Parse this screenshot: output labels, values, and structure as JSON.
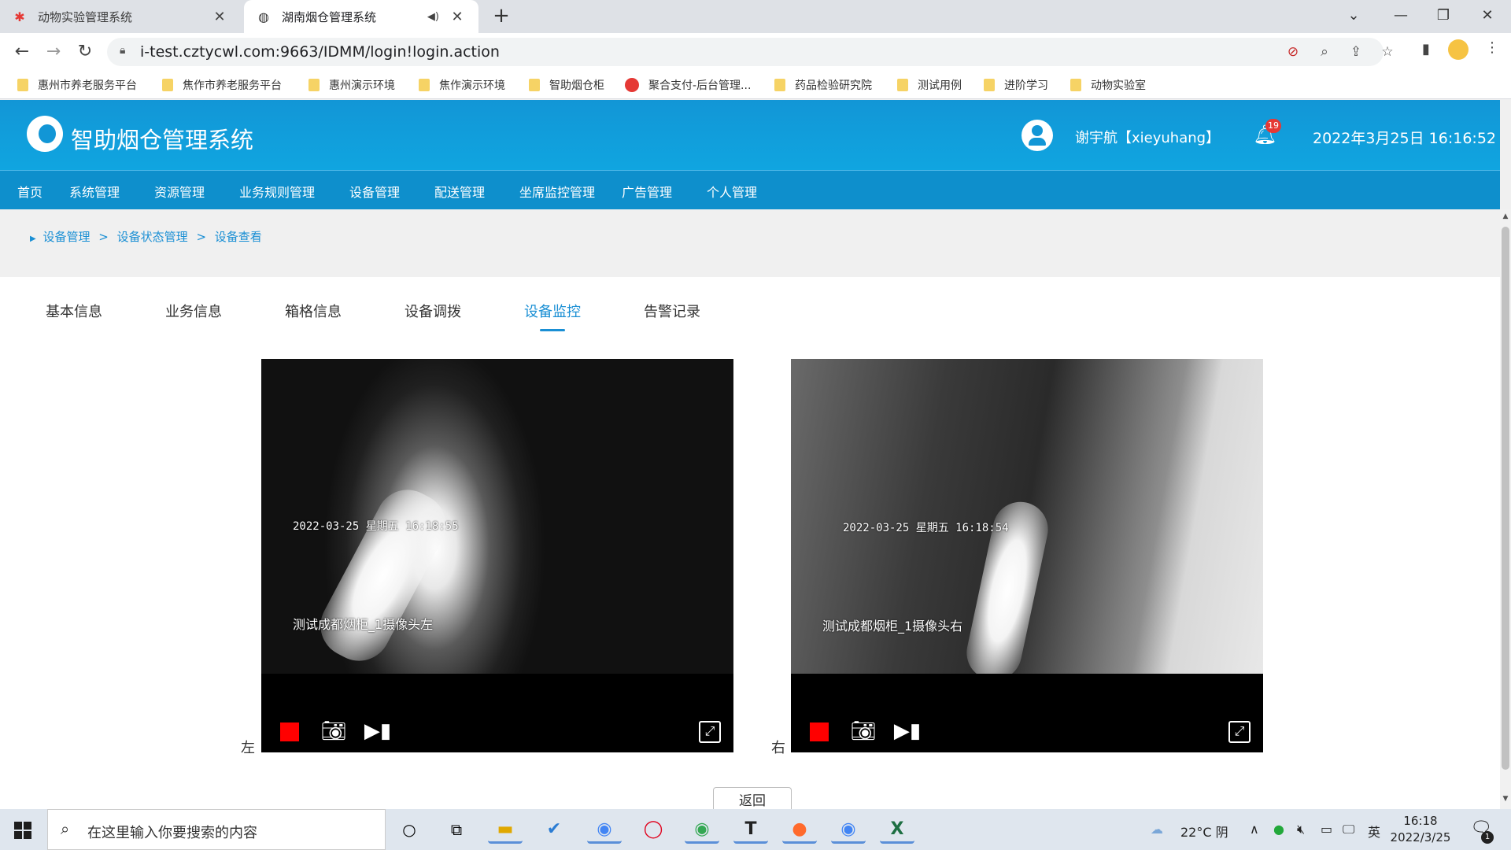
{
  "browser": {
    "tabs": [
      {
        "label": "动物实验管理系统",
        "close": "✕"
      },
      {
        "label": "湖南烟仓管理系统",
        "close": "✕"
      }
    ],
    "new_tab": "+",
    "window": {
      "minimize": "⌄",
      "min": "—",
      "restore": "❐",
      "close": "✕"
    },
    "url": "i-test.cztycwl.com:9663/IDMM/login!login.action",
    "bookmarks": [
      "惠州市养老服务平台",
      "焦作市养老服务平台",
      "惠州演示环境",
      "焦作演示环境",
      "智助烟仓柜",
      "聚合支付-后台管理...",
      "药品检验研究院",
      "测试用例",
      "进阶学习",
      "动物实验室"
    ]
  },
  "header": {
    "title": "智助烟仓管理系统",
    "user": "谢宇航【xieyuhang】",
    "notification_count": "19",
    "datetime": "2022年3月25日 16:16:52"
  },
  "nav": {
    "items": [
      "首页",
      "系统管理",
      "资源管理",
      "业务规则管理",
      "设备管理",
      "配送管理",
      "坐席监控管理",
      "广告管理",
      "个人管理"
    ]
  },
  "breadcrumb": [
    "设备管理",
    "设备状态管理",
    "设备查看"
  ],
  "page_tabs": {
    "items": [
      "基本信息",
      "业务信息",
      "箱格信息",
      "设备调拨",
      "设备监控",
      "告警记录"
    ],
    "active_index": 4
  },
  "cameras": [
    {
      "label": "左",
      "timestamp": "2022-03-25 星期五 16:18:55",
      "name": "测试成都烟柜_1摄像头左"
    },
    {
      "label": "右",
      "timestamp": "2022-03-25 星期五 16:18:54",
      "name": "测试成都烟柜_1摄像头右"
    }
  ],
  "actions": {
    "back": "返回"
  },
  "taskbar": {
    "search_placeholder": "在这里输入你要搜索的内容",
    "weather": "22°C 阴",
    "ime": "英",
    "time": "16:18",
    "date": "2022/3/25",
    "notif_count": "1"
  }
}
